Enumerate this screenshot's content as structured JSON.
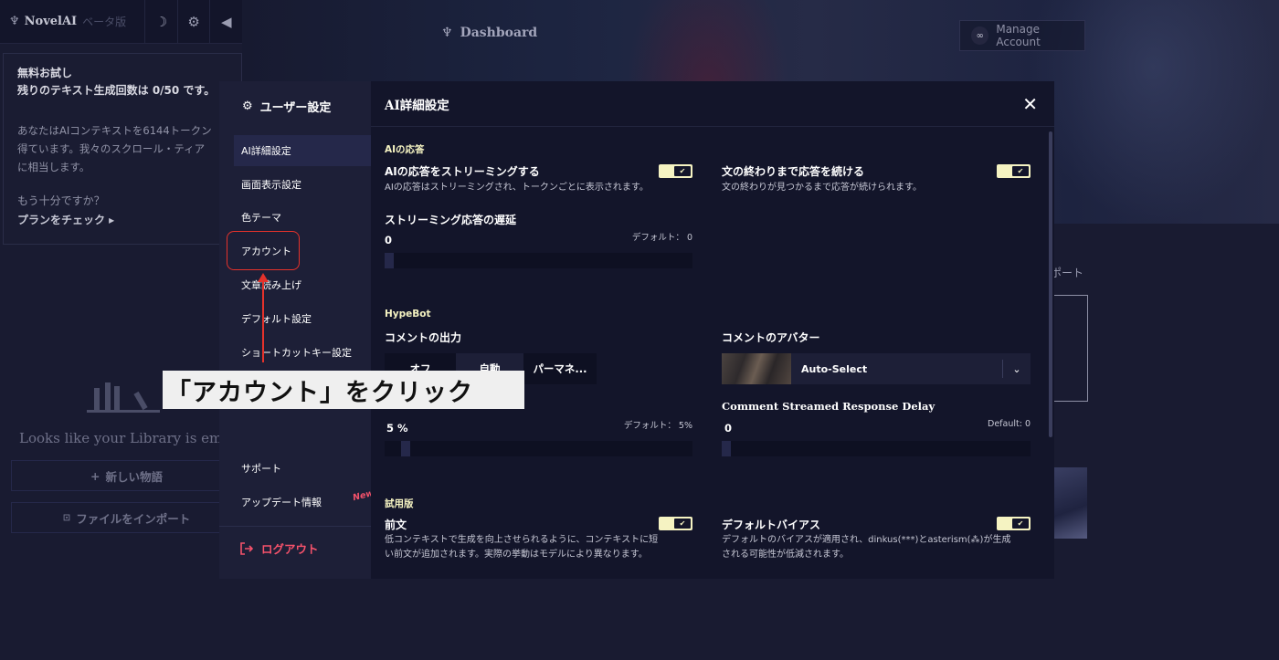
{
  "app": {
    "brand_name": "NovelAI",
    "brand_beta": "ベータ版"
  },
  "trial": {
    "title_line1": "無料お試し",
    "title_line2": "残りのテキスト生成回数は 0/50 です。",
    "desc_line1": "あなたはAIコンテキストを6144トークン",
    "desc_line2": "得ています。我々のスクロール・ティア",
    "desc_line3": "に相当します。",
    "question": "もう十分ですか？",
    "plan_link": "プランをチェック ▸"
  },
  "header": {
    "dashboard_title": "Dashboard",
    "manage_account": "Manage Account"
  },
  "background": {
    "support_label": "ポート",
    "empty_library": "Looks like your Library is empty",
    "new_story": "新しい物語",
    "import_file": "ファイルをインポート"
  },
  "modal": {
    "side_title": "ユーザー設定",
    "nav": [
      {
        "label": "AI詳細設定"
      },
      {
        "label": "画面表示設定"
      },
      {
        "label": "色テーマ"
      },
      {
        "label": "アカウント"
      },
      {
        "label": "文章読み上げ"
      },
      {
        "label": "デフォルト設定"
      },
      {
        "label": "ショートカットキー設定"
      },
      {
        "label": "サポート"
      },
      {
        "label": "アップデート情報"
      }
    ],
    "new_badge": "New!",
    "logout": "ログアウト",
    "main_title": "AI詳細設定",
    "ai_section": "AIの応答",
    "streaming_title": "AIの応答をストリーミングする",
    "streaming_desc": "AIの応答はストリーミングされ、トークンごとに表示されます。",
    "continue_title": "文の終わりまで応答を続ける",
    "continue_desc": "文の終わりが見つかるまで応答が続けられます。",
    "delay_title": "ストリーミング応答の遅延",
    "delay_value": "0",
    "delay_default": "デフォルト： 0",
    "hypebot_section": "HypeBot",
    "comment_output_title": "コメントの出力",
    "comment_output_options": [
      "オフ",
      "自動",
      "パーマネ..."
    ],
    "comment_avatar_title": "コメントのアバター",
    "avatar_select_value": "Auto-Select",
    "comment_freq_value": "5 %",
    "comment_freq_default": "デフォルト： 5%",
    "comment_delay_title": "Comment Streamed Response Delay",
    "comment_delay_value": "0",
    "comment_delay_default": "Default: 0",
    "trial_section": "試用版",
    "preamble_title": "前文",
    "preamble_desc_line1": "低コンテキストで生成を向上させられるように、コンテキストに短",
    "preamble_desc_line2": "い前文が追加されます。実際の挙動はモデルにより異なります。",
    "default_bias_title": "デフォルトバイアス",
    "default_bias_desc_line1": "デフォルトのバイアスが適用され、dinkus(***)とasterism(⁂)が生成",
    "default_bias_desc_line2": "される可能性が低減されます。"
  },
  "annotation": {
    "text": "「アカウント」をクリック"
  },
  "toggles": {
    "streaming": true,
    "continue": true,
    "preamble": true,
    "default_bias": true
  },
  "sliders": {
    "delay": 0,
    "comment_freq": 5,
    "comment_delay": 0
  },
  "colors": {
    "accent_cream": "#f5f3c2",
    "logout_red": "#f5526b",
    "annotation_red": "#e5322b"
  }
}
